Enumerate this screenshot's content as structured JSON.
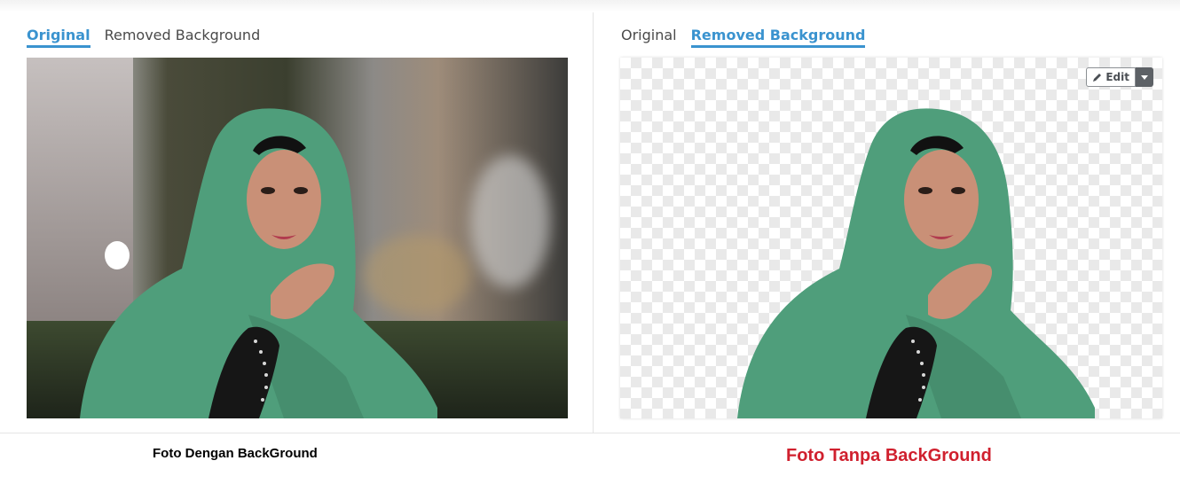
{
  "left_panel": {
    "tabs": [
      {
        "label": "Original",
        "active": true
      },
      {
        "label": "Removed Background",
        "active": false
      }
    ]
  },
  "right_panel": {
    "tabs": [
      {
        "label": "Original",
        "active": false
      },
      {
        "label": "Removed Background",
        "active": true
      }
    ],
    "edit_button": {
      "label": "Edit",
      "icon": "pencil-icon",
      "dropdown_icon": "caret-down-icon"
    }
  },
  "captions": {
    "left": "Foto Dengan BackGround",
    "right": "Foto Tanpa BackGround"
  },
  "colors": {
    "accent": "#3a93cf",
    "caption_right": "#d0202e",
    "scarf": "#4f9e7b"
  }
}
